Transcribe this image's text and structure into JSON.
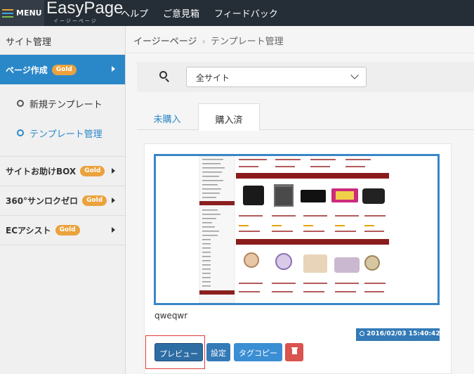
{
  "topbar": {
    "menu_label": "MENU",
    "logo_text": "EasyPage",
    "logo_sub": "イージーページ",
    "nav": [
      "ヘルプ",
      "ご意見箱",
      "フィードバック"
    ]
  },
  "sidebar": {
    "heading": "サイト管理",
    "items": [
      {
        "label": "ページ作成",
        "badge": "Gold",
        "active": true
      },
      {
        "label": "サイトお助けBOX",
        "badge": "Gold"
      },
      {
        "label": "360°サンロクゼロ",
        "badge": "Gold"
      },
      {
        "label": "ECアシスト",
        "badge": "Gold"
      }
    ],
    "subitems": [
      "新規テンプレート",
      "テンプレート管理"
    ]
  },
  "breadcrumb": {
    "home": "イージーページ",
    "separator": "›",
    "current": "テンプレート管理"
  },
  "search": {
    "selected": "全サイト"
  },
  "tabs": [
    "未購入",
    "購入済"
  ],
  "template": {
    "name": "qweqwr",
    "timestamp": "2016/02/03 15:40:42"
  },
  "buttons": {
    "preview": "プレビュー",
    "settings": "設定",
    "tagcopy": "タグコピー"
  },
  "colors": {
    "accent": "#2a88c9",
    "gold": "#eba23c",
    "topbar": "#252d36",
    "danger": "#d9534f",
    "primary": "#337ab7"
  }
}
